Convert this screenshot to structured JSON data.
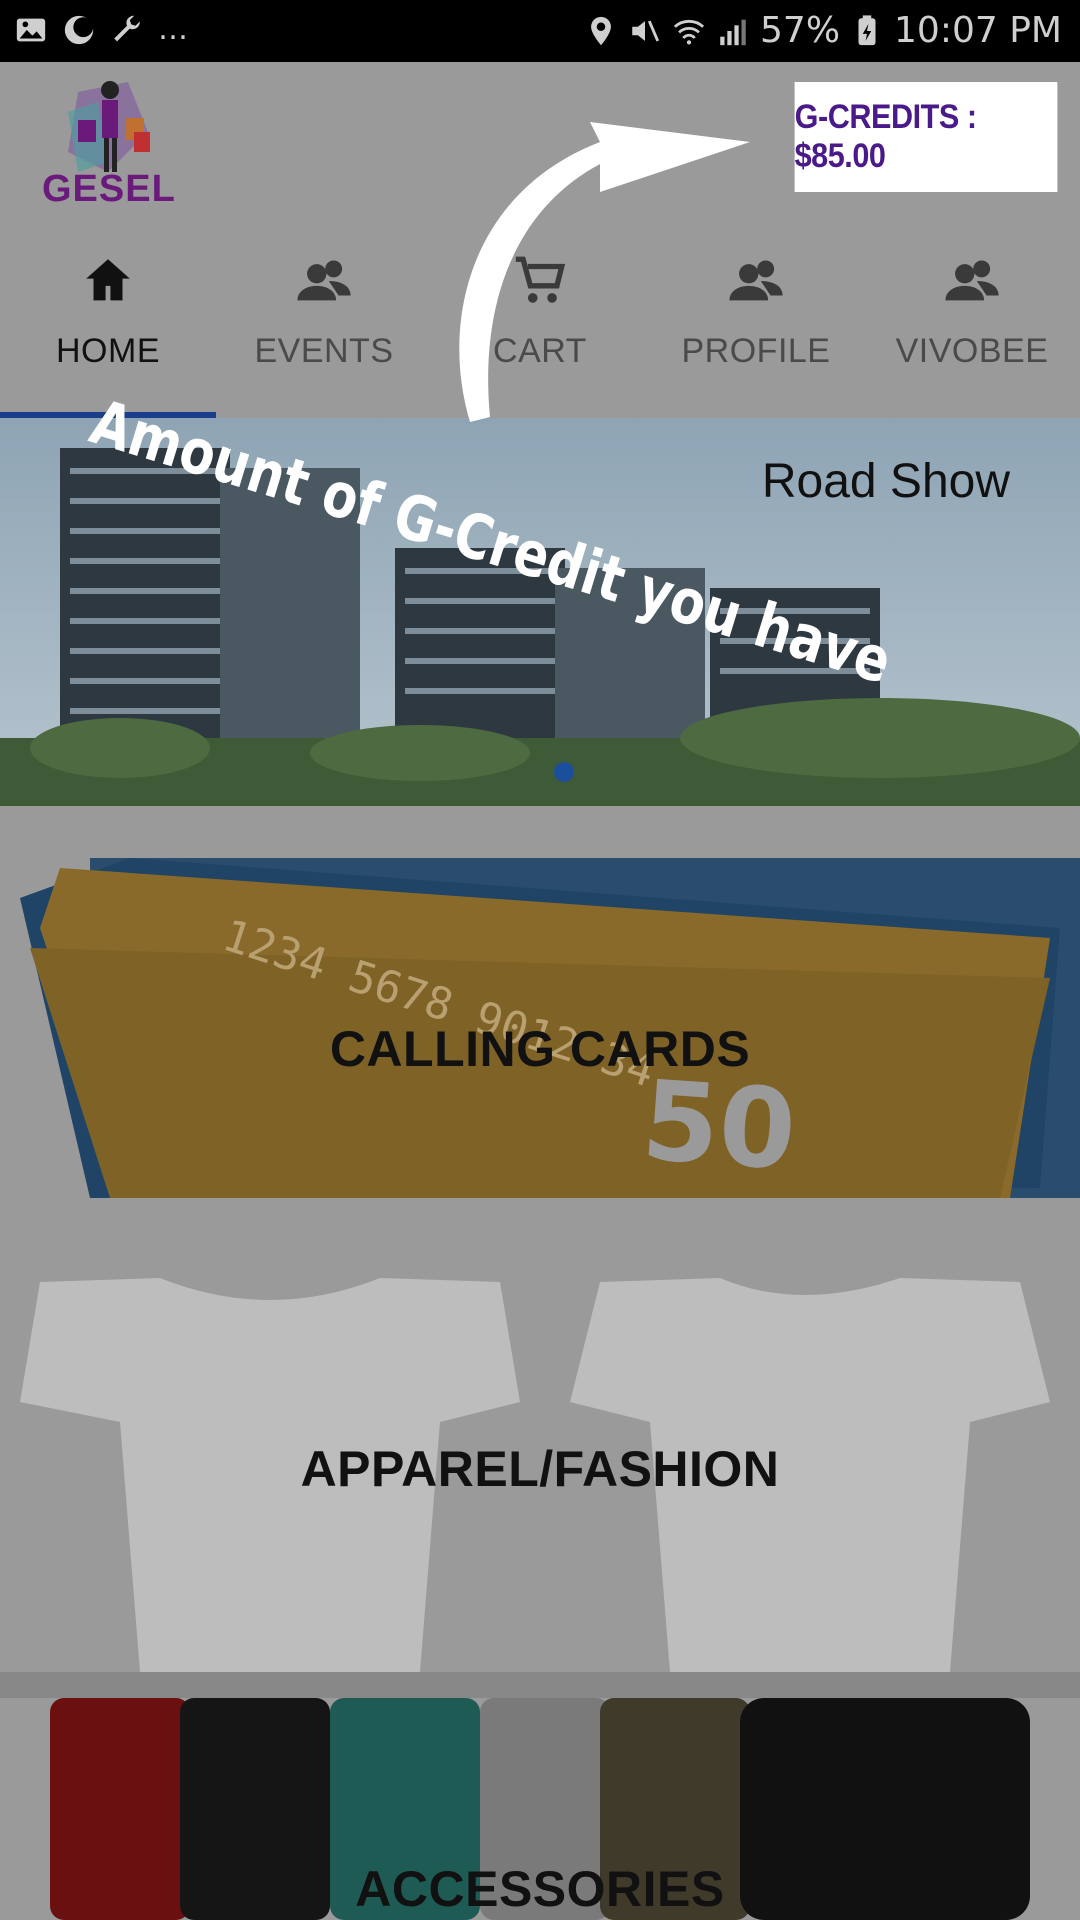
{
  "status_bar": {
    "left_overflow": "…",
    "battery": "57%",
    "time": "10:07 PM"
  },
  "header": {
    "logo_text": "GESEL",
    "credits_label": "G-CREDITS : $85.00"
  },
  "tabs": [
    {
      "label": "HOME",
      "icon": "home-icon",
      "active": true
    },
    {
      "label": "EVENTS",
      "icon": "people-icon",
      "active": false
    },
    {
      "label": "CART",
      "icon": "cart-icon",
      "active": false
    },
    {
      "label": "PROFILE",
      "icon": "people-icon",
      "active": false
    },
    {
      "label": "VIVOBEE",
      "icon": "people-icon",
      "active": false
    }
  ],
  "banner": {
    "caption": "Road Show",
    "slide_dots": 1
  },
  "categories": [
    {
      "label": "CALLING CARDS"
    },
    {
      "label": "APPAREL/FASHION"
    },
    {
      "label": "ACCESSORIES"
    }
  ],
  "overlay": {
    "annotation_text": "Amount of G-Credit you have"
  },
  "colors": {
    "accent": "#1a3f8a",
    "credits_text": "#4b1a8a",
    "logo": "#6a1a7a"
  }
}
